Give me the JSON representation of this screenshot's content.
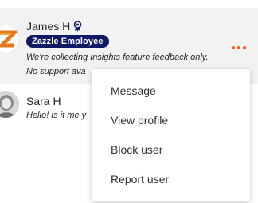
{
  "conversations": [
    {
      "name": "James H",
      "badge": "Zazzle Employee",
      "message_line_1": "We're collecting Insights feature feedback only.",
      "message_line_2": "No support ava",
      "icon": "award-ribbon-icon"
    },
    {
      "name": "Sara H",
      "message": "Hello! Is it me y"
    }
  ],
  "menu": {
    "items": [
      "Message",
      "View profile",
      "Block user",
      "Report user"
    ]
  },
  "colors": {
    "badge_bg": "#0f1a63",
    "accent_dots": "#ff5a1f",
    "selected_row": "#f2f2f2"
  }
}
